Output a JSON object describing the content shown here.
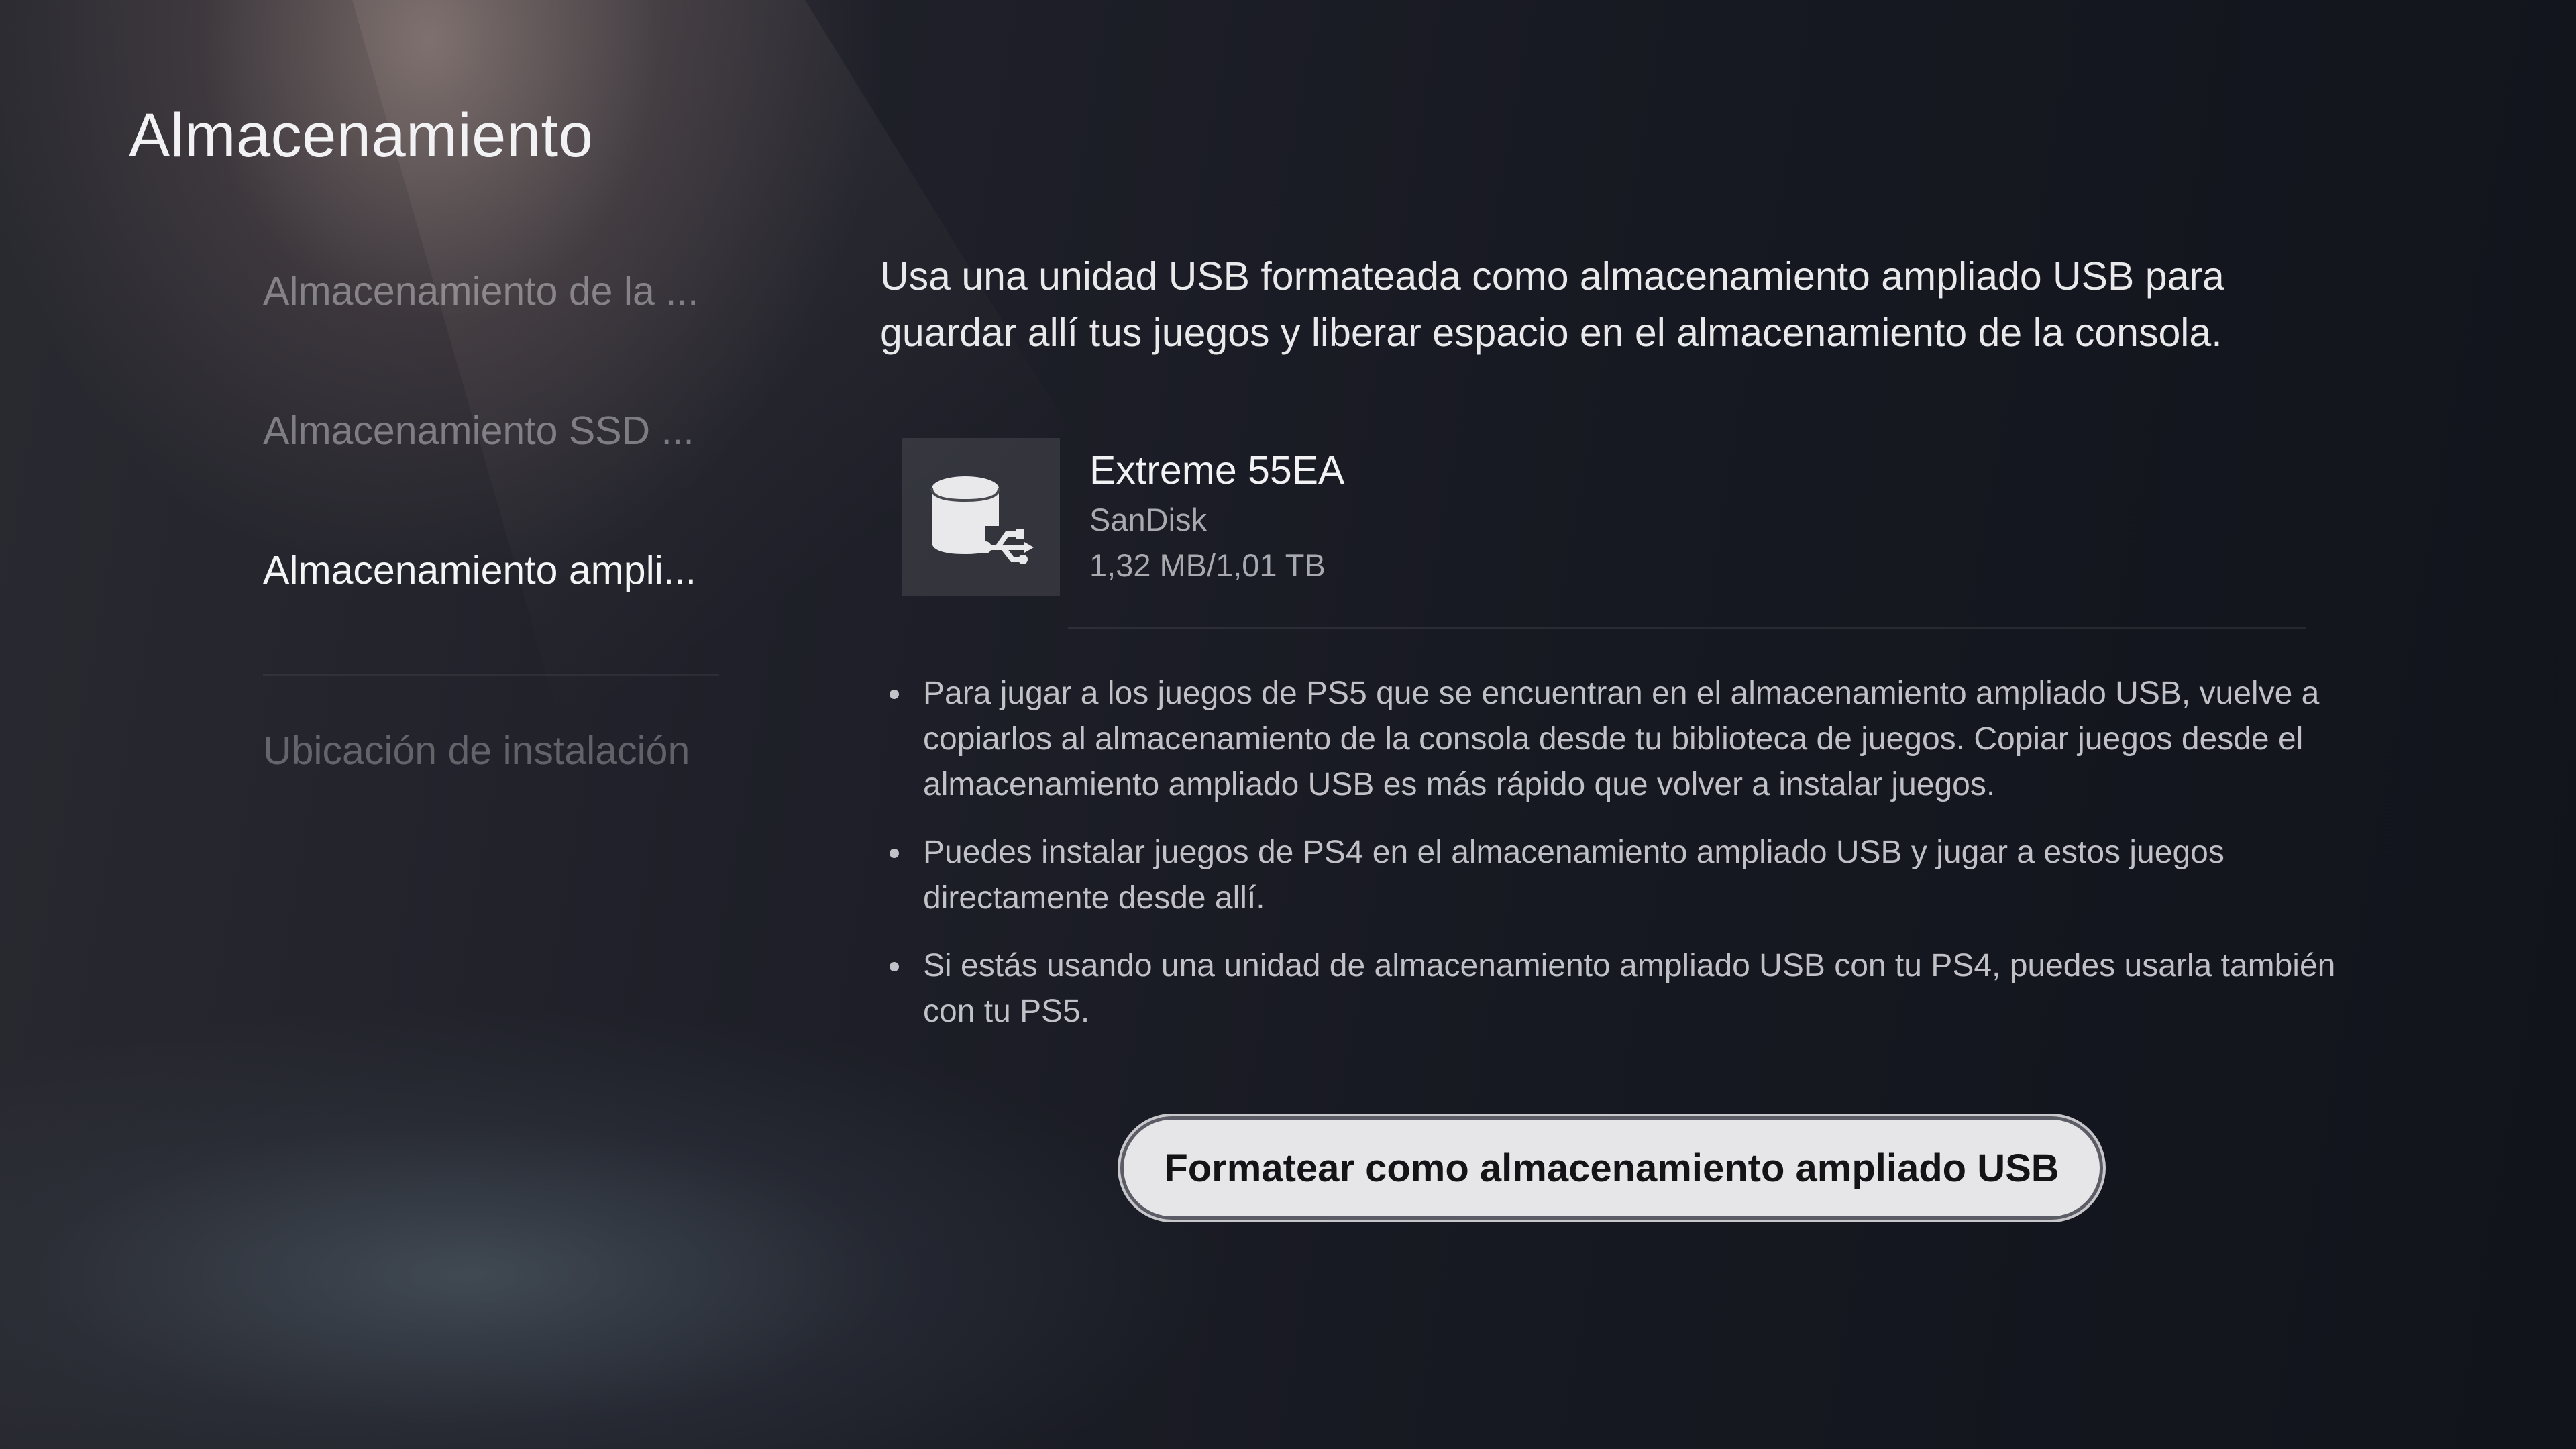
{
  "header": {
    "title": "Almacenamiento"
  },
  "sidebar": {
    "items": [
      {
        "label": "Almacenamiento de la ..."
      },
      {
        "label": "Almacenamiento SSD ..."
      },
      {
        "label": "Almacenamiento ampli..."
      },
      {
        "label": "Ubicación de instalación"
      }
    ],
    "active_index": 2
  },
  "main": {
    "intro": "Usa una unidad USB formateada como almacenamiento ampliado USB para guardar allí tus juegos y liberar espacio en el almacenamiento de la consola.",
    "device": {
      "icon": "usb-drive-icon",
      "name": "Extreme 55EA",
      "brand": "SanDisk",
      "size": "1,32 MB/1,01 TB"
    },
    "bullets": [
      "Para jugar a los juegos de PS5 que se encuentran en el almacenamiento ampliado USB, vuelve a copiarlos al almacenamiento de la consola desde tu biblioteca de juegos. Copiar juegos desde el almacenamiento ampliado USB es más rápido que volver a instalar juegos.",
      "Puedes instalar juegos de PS4 en el almacenamiento ampliado USB y jugar a estos juegos directamente desde allí.",
      "Si estás usando una unidad de almacenamiento ampliado USB con tu PS4, puedes usarla también con tu PS5."
    ],
    "format_button": "Formatear como almacenamiento ampliado USB"
  }
}
